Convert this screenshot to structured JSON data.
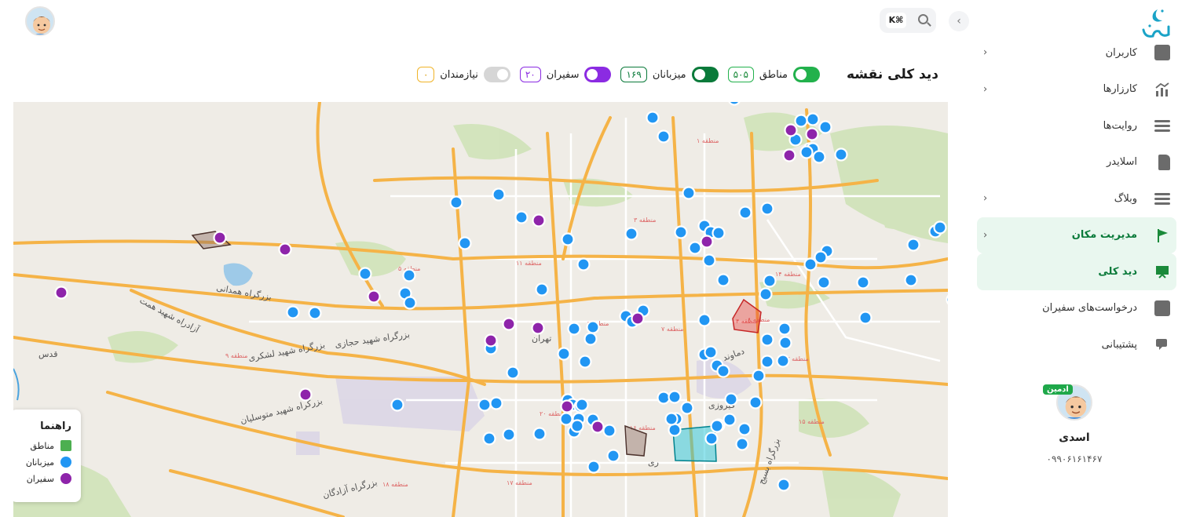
{
  "sidebar": {
    "collapse_icon": "chevron-left-icon",
    "items": [
      {
        "label": "کاربران",
        "icon": "user-icon",
        "chevron": "›",
        "state": "normal"
      },
      {
        "label": "کارزارها",
        "icon": "chart-icon",
        "chevron": "›",
        "state": "normal"
      },
      {
        "label": "روایت‌ها",
        "icon": "list-icon",
        "chevron": "",
        "state": "normal"
      },
      {
        "label": "اسلایدر",
        "icon": "document-icon",
        "chevron": "",
        "state": "normal"
      },
      {
        "label": "وبلاگ",
        "icon": "list-icon",
        "chevron": "›",
        "state": "normal"
      },
      {
        "label": "مدیریت مکان",
        "icon": "flag-icon",
        "chevron": "›",
        "state": "open"
      },
      {
        "label": "دید کلی",
        "icon": "monitor-icon",
        "chevron": "",
        "state": "active"
      },
      {
        "label": "درخواست‌های سفیران",
        "icon": "user-icon",
        "chevron": "",
        "state": "normal"
      },
      {
        "label": "پشتیبانی",
        "icon": "chat-icon",
        "chevron": "",
        "state": "normal"
      }
    ]
  },
  "profile": {
    "badge": "ادمین",
    "name": "اسدی",
    "phone": "۰۹۹۰۶۱۶۱۴۶۷"
  },
  "search": {
    "shortcut": "K⌘"
  },
  "overview": {
    "title": "دید کلی نقشه",
    "layers": [
      {
        "label": "مناطق",
        "count": "۵۰۵",
        "enabled": true,
        "color": "#22b14c"
      },
      {
        "label": "میزبانان",
        "count": "۱۶۹",
        "enabled": true,
        "color": "#0a7a3a"
      },
      {
        "label": "سفیران",
        "count": "۲۰",
        "enabled": true,
        "color": "#8b2be2"
      },
      {
        "label": "نیازمندان",
        "count": "۰",
        "enabled": false,
        "color": "#f0b429"
      }
    ]
  },
  "map": {
    "labels": [
      "بزرگراه همدانی",
      "آزادراه شهید همت",
      "بزرگراه شهید حجازی",
      "بزرگراه شهید لشکری",
      "بزرگراه شهید متوسلیان",
      "بزرگراه آزادگان",
      "قدس",
      "فیروزی",
      "دماوند",
      "بزرگراه بسیج",
      "ری",
      "تهران"
    ],
    "districts": [
      "منطقه ۱",
      "منطقه ۳",
      "منطقه ۴",
      "منطقه ۵",
      "منطقه ۶",
      "منطقه ۷",
      "منطقه ۸",
      "منطقه ۹",
      "منطقه ۱۱",
      "منطقه ۱۳",
      "منطقه ۱۴",
      "منطقه ۱۵",
      "منطقه ۱۶",
      "منطقه ۱۷",
      "منطقه ۱۸",
      "منطقه ۲۰"
    ],
    "colors": {
      "host": "#2196f3",
      "ambassador": "#8e24aa",
      "region": "#4caf50"
    }
  },
  "legend": {
    "title": "راهنما",
    "items": [
      {
        "label": "مناطق",
        "shape": "square",
        "color": "#4caf50"
      },
      {
        "label": "میزبانان",
        "shape": "circle",
        "color": "#2196f3"
      },
      {
        "label": "سفیران",
        "shape": "circle",
        "color": "#8e24aa"
      }
    ]
  }
}
